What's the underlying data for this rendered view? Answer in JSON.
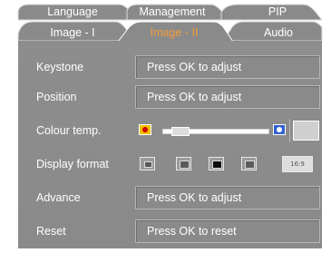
{
  "tabs_row1": [
    {
      "label": "Language",
      "active": false
    },
    {
      "label": "Management",
      "active": false
    },
    {
      "label": "PIP",
      "active": false
    }
  ],
  "tabs_row2": [
    {
      "label": "Image - I",
      "active": false
    },
    {
      "label": "Image - II",
      "active": true
    },
    {
      "label": "Audio",
      "active": false
    }
  ],
  "menu": {
    "keystone": {
      "label": "Keystone",
      "value": "Press OK to adjust"
    },
    "position": {
      "label": "Position",
      "value": "Press OK to adjust"
    },
    "colour_temp": {
      "label": "Colour temp.",
      "level": 0.1,
      "warm_icon": "warm-temperature-icon",
      "cool_icon": "cool-temperature-icon"
    },
    "display_format": {
      "label": "Display format",
      "options": [
        "4:3 normal",
        "4:3",
        "window",
        "native",
        "16:9"
      ],
      "selected_index": 2,
      "wide_label": "16:9"
    },
    "advance": {
      "label": "Advance",
      "value": "Press OK to adjust"
    },
    "reset": {
      "label": "Reset",
      "value": "Press OK to reset"
    }
  },
  "colors": {
    "tab_bg": "#808080",
    "tab_active_bg": "#ffffff",
    "tab_active_text": "#f39c3a",
    "panel_bg": "#8a8a8a",
    "text": "#ffffff"
  }
}
